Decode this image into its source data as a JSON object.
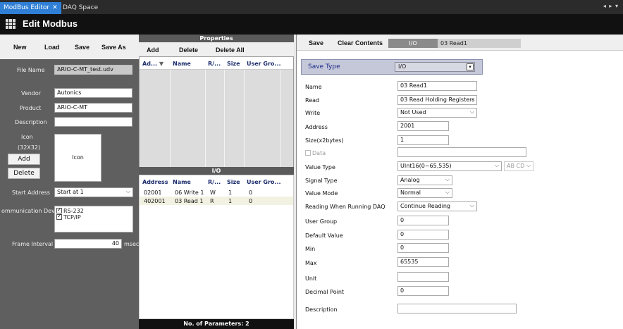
{
  "tabs": [
    {
      "label": "ModBus Editor",
      "close": "✕",
      "active": true
    },
    {
      "label": "DAQ Space",
      "active": false
    }
  ],
  "tab_menu": "◂ ▸ ▾",
  "title": "Edit Modbus",
  "left": {
    "toolbar": {
      "new": "New",
      "load": "Load",
      "save": "Save",
      "save_as": "Save As"
    },
    "file_name_label": "File Name",
    "file_name_value": "ARIO-C-MT_test.udv",
    "vendor_label": "Vendor",
    "vendor_value": "Autonics",
    "product_label": "Product",
    "product_value": "ARIO-C-MT",
    "description_label": "Description",
    "description_value": "",
    "icon_label": "Icon",
    "icon_size_label": "(32X32)",
    "icon_preview_text": "Icon",
    "add_button": "Add",
    "delete_button": "Delete",
    "start_address_label": "Start Address",
    "start_address_value": "Start at 1",
    "comm_device_label": "ommunication Devi",
    "comm_options": [
      {
        "label": "RS-232",
        "checked": true
      },
      {
        "label": "TCP/IP",
        "checked": true
      }
    ],
    "frame_interval_label": "Frame Interval",
    "frame_interval_value": "40",
    "frame_interval_unit": "msec"
  },
  "middle": {
    "properties_header": "Properties",
    "toolbar": {
      "add": "Add",
      "delete": "Delete",
      "delete_all": "Delete All"
    },
    "properties_columns": [
      "Ad...",
      "Name",
      "R/...",
      "Size",
      "User Gro..."
    ],
    "sort_indicator": "▼",
    "io_header": "I/O",
    "io_columns": [
      "Address",
      "Name",
      "R/...",
      "Size",
      "User Gro..."
    ],
    "io_rows": [
      [
        "02001",
        "06 Write 1",
        "W",
        "1",
        "0"
      ],
      [
        "402001",
        "03 Read 1",
        "R",
        "1",
        "0"
      ]
    ],
    "footer": "No. of Parameters: 2"
  },
  "right": {
    "toolbar": {
      "save": "Save",
      "clear_contents": "Clear Contents",
      "io_tab": "I/O",
      "current_item": "03 Read1"
    },
    "save_type_label": "Save Type",
    "save_type_value": "I/O",
    "fields": {
      "name": {
        "label": "Name",
        "value": "03 Read1"
      },
      "read": {
        "label": "Read",
        "value": "03 Read Holding Registers"
      },
      "write": {
        "label": "Write",
        "value": "Not Used"
      },
      "address": {
        "label": "Address",
        "value": "2001"
      },
      "size": {
        "label": "Size(x2bytes)",
        "value": "1"
      },
      "data": {
        "label": "Data",
        "value": ""
      },
      "value_type": {
        "label": "Value Type",
        "value": "UInt16(0~65,535)",
        "byte_order": "AB CD"
      },
      "signal_type": {
        "label": "Signal Type",
        "value": "Analog"
      },
      "value_mode": {
        "label": "Value Mode",
        "value": "Normal"
      },
      "reading": {
        "label": "Reading When Running DAQ",
        "value": "Continue Reading"
      },
      "user_group": {
        "label": "User Group",
        "value": "0"
      },
      "default_value": {
        "label": "Default Value",
        "value": "0"
      },
      "min": {
        "label": "Min",
        "value": "0"
      },
      "max": {
        "label": "Max",
        "value": "65535"
      },
      "unit": {
        "label": "Unit",
        "value": ""
      },
      "decimal_point": {
        "label": "Decimal Point",
        "value": "0"
      },
      "description": {
        "label": "Description",
        "value": ""
      }
    }
  },
  "colors": {
    "tab_active": "#2f7fd6",
    "title_bar": "#111111",
    "left_panel": "#5f5f5f",
    "header_text": "#1a2b6b"
  }
}
